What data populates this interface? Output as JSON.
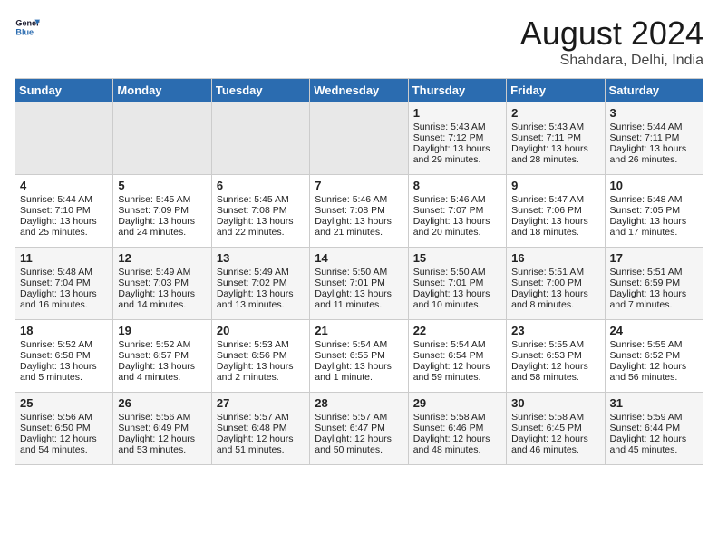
{
  "header": {
    "logo_line1": "General",
    "logo_line2": "Blue",
    "title": "August 2024",
    "subtitle": "Shahdara, Delhi, India"
  },
  "weekdays": [
    "Sunday",
    "Monday",
    "Tuesday",
    "Wednesday",
    "Thursday",
    "Friday",
    "Saturday"
  ],
  "weeks": [
    [
      {
        "day": "",
        "content": ""
      },
      {
        "day": "",
        "content": ""
      },
      {
        "day": "",
        "content": ""
      },
      {
        "day": "",
        "content": ""
      },
      {
        "day": "1",
        "content": "Sunrise: 5:43 AM\nSunset: 7:12 PM\nDaylight: 13 hours\nand 29 minutes."
      },
      {
        "day": "2",
        "content": "Sunrise: 5:43 AM\nSunset: 7:11 PM\nDaylight: 13 hours\nand 28 minutes."
      },
      {
        "day": "3",
        "content": "Sunrise: 5:44 AM\nSunset: 7:11 PM\nDaylight: 13 hours\nand 26 minutes."
      }
    ],
    [
      {
        "day": "4",
        "content": "Sunrise: 5:44 AM\nSunset: 7:10 PM\nDaylight: 13 hours\nand 25 minutes."
      },
      {
        "day": "5",
        "content": "Sunrise: 5:45 AM\nSunset: 7:09 PM\nDaylight: 13 hours\nand 24 minutes."
      },
      {
        "day": "6",
        "content": "Sunrise: 5:45 AM\nSunset: 7:08 PM\nDaylight: 13 hours\nand 22 minutes."
      },
      {
        "day": "7",
        "content": "Sunrise: 5:46 AM\nSunset: 7:08 PM\nDaylight: 13 hours\nand 21 minutes."
      },
      {
        "day": "8",
        "content": "Sunrise: 5:46 AM\nSunset: 7:07 PM\nDaylight: 13 hours\nand 20 minutes."
      },
      {
        "day": "9",
        "content": "Sunrise: 5:47 AM\nSunset: 7:06 PM\nDaylight: 13 hours\nand 18 minutes."
      },
      {
        "day": "10",
        "content": "Sunrise: 5:48 AM\nSunset: 7:05 PM\nDaylight: 13 hours\nand 17 minutes."
      }
    ],
    [
      {
        "day": "11",
        "content": "Sunrise: 5:48 AM\nSunset: 7:04 PM\nDaylight: 13 hours\nand 16 minutes."
      },
      {
        "day": "12",
        "content": "Sunrise: 5:49 AM\nSunset: 7:03 PM\nDaylight: 13 hours\nand 14 minutes."
      },
      {
        "day": "13",
        "content": "Sunrise: 5:49 AM\nSunset: 7:02 PM\nDaylight: 13 hours\nand 13 minutes."
      },
      {
        "day": "14",
        "content": "Sunrise: 5:50 AM\nSunset: 7:01 PM\nDaylight: 13 hours\nand 11 minutes."
      },
      {
        "day": "15",
        "content": "Sunrise: 5:50 AM\nSunset: 7:01 PM\nDaylight: 13 hours\nand 10 minutes."
      },
      {
        "day": "16",
        "content": "Sunrise: 5:51 AM\nSunset: 7:00 PM\nDaylight: 13 hours\nand 8 minutes."
      },
      {
        "day": "17",
        "content": "Sunrise: 5:51 AM\nSunset: 6:59 PM\nDaylight: 13 hours\nand 7 minutes."
      }
    ],
    [
      {
        "day": "18",
        "content": "Sunrise: 5:52 AM\nSunset: 6:58 PM\nDaylight: 13 hours\nand 5 minutes."
      },
      {
        "day": "19",
        "content": "Sunrise: 5:52 AM\nSunset: 6:57 PM\nDaylight: 13 hours\nand 4 minutes."
      },
      {
        "day": "20",
        "content": "Sunrise: 5:53 AM\nSunset: 6:56 PM\nDaylight: 13 hours\nand 2 minutes."
      },
      {
        "day": "21",
        "content": "Sunrise: 5:54 AM\nSunset: 6:55 PM\nDaylight: 13 hours\nand 1 minute."
      },
      {
        "day": "22",
        "content": "Sunrise: 5:54 AM\nSunset: 6:54 PM\nDaylight: 12 hours\nand 59 minutes."
      },
      {
        "day": "23",
        "content": "Sunrise: 5:55 AM\nSunset: 6:53 PM\nDaylight: 12 hours\nand 58 minutes."
      },
      {
        "day": "24",
        "content": "Sunrise: 5:55 AM\nSunset: 6:52 PM\nDaylight: 12 hours\nand 56 minutes."
      }
    ],
    [
      {
        "day": "25",
        "content": "Sunrise: 5:56 AM\nSunset: 6:50 PM\nDaylight: 12 hours\nand 54 minutes."
      },
      {
        "day": "26",
        "content": "Sunrise: 5:56 AM\nSunset: 6:49 PM\nDaylight: 12 hours\nand 53 minutes."
      },
      {
        "day": "27",
        "content": "Sunrise: 5:57 AM\nSunset: 6:48 PM\nDaylight: 12 hours\nand 51 minutes."
      },
      {
        "day": "28",
        "content": "Sunrise: 5:57 AM\nSunset: 6:47 PM\nDaylight: 12 hours\nand 50 minutes."
      },
      {
        "day": "29",
        "content": "Sunrise: 5:58 AM\nSunset: 6:46 PM\nDaylight: 12 hours\nand 48 minutes."
      },
      {
        "day": "30",
        "content": "Sunrise: 5:58 AM\nSunset: 6:45 PM\nDaylight: 12 hours\nand 46 minutes."
      },
      {
        "day": "31",
        "content": "Sunrise: 5:59 AM\nSunset: 6:44 PM\nDaylight: 12 hours\nand 45 minutes."
      }
    ]
  ]
}
